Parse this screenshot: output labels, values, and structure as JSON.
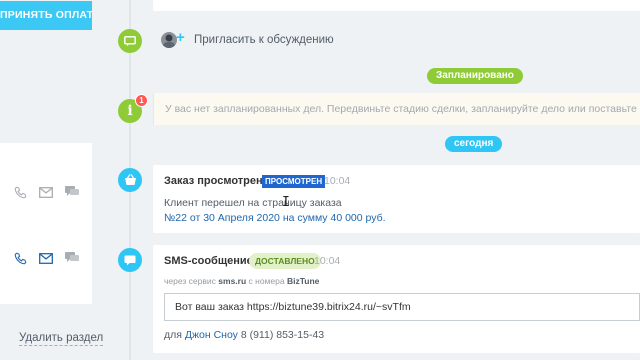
{
  "sidebar": {
    "accept_payment": "ПРИНЯТЬ ОПЛАТУ",
    "delete_section": "Удалить раздел",
    "contact_icons": [
      "phone-icon",
      "mail-icon",
      "chat-icon"
    ]
  },
  "timeline": {
    "invite": {
      "label": "Пригласить к обсуждению"
    },
    "planned_label": "Запланировано",
    "notice": {
      "badge": "1",
      "text": "У вас нет запланированных дел. Передвиньте стадию сделки, запланируйте дело или поставьте ожида"
    },
    "today_label": "сегодня",
    "order_viewed": {
      "title": "Заказ просмотрен",
      "tag": "ПРОСМОТРЕН",
      "time": "10:04",
      "line1": "Клиент перешел на страницу заказа",
      "line2": "№22 от 30 Апреля 2020 на сумму 40 000 руб."
    },
    "sms": {
      "title": "SMS-сообщение",
      "tag": "ДОСТАВЛЕНО",
      "time": "10:04",
      "via_prefix": "через сервис",
      "service": "sms.ru",
      "via_mid": "с номера",
      "sender": "BizTune",
      "message": "Вот ваш заказ https://biztune39.bitrix24.ru/~svTfm",
      "to_prefix": "для",
      "to_name": "Джон Сноу",
      "to_phone": "8 (911) 853-15-43"
    }
  },
  "colors": {
    "accent": "#3bc8f5",
    "green": "#8ecb36",
    "blue_link": "#2067b0",
    "alert_red": "#ff5752"
  }
}
